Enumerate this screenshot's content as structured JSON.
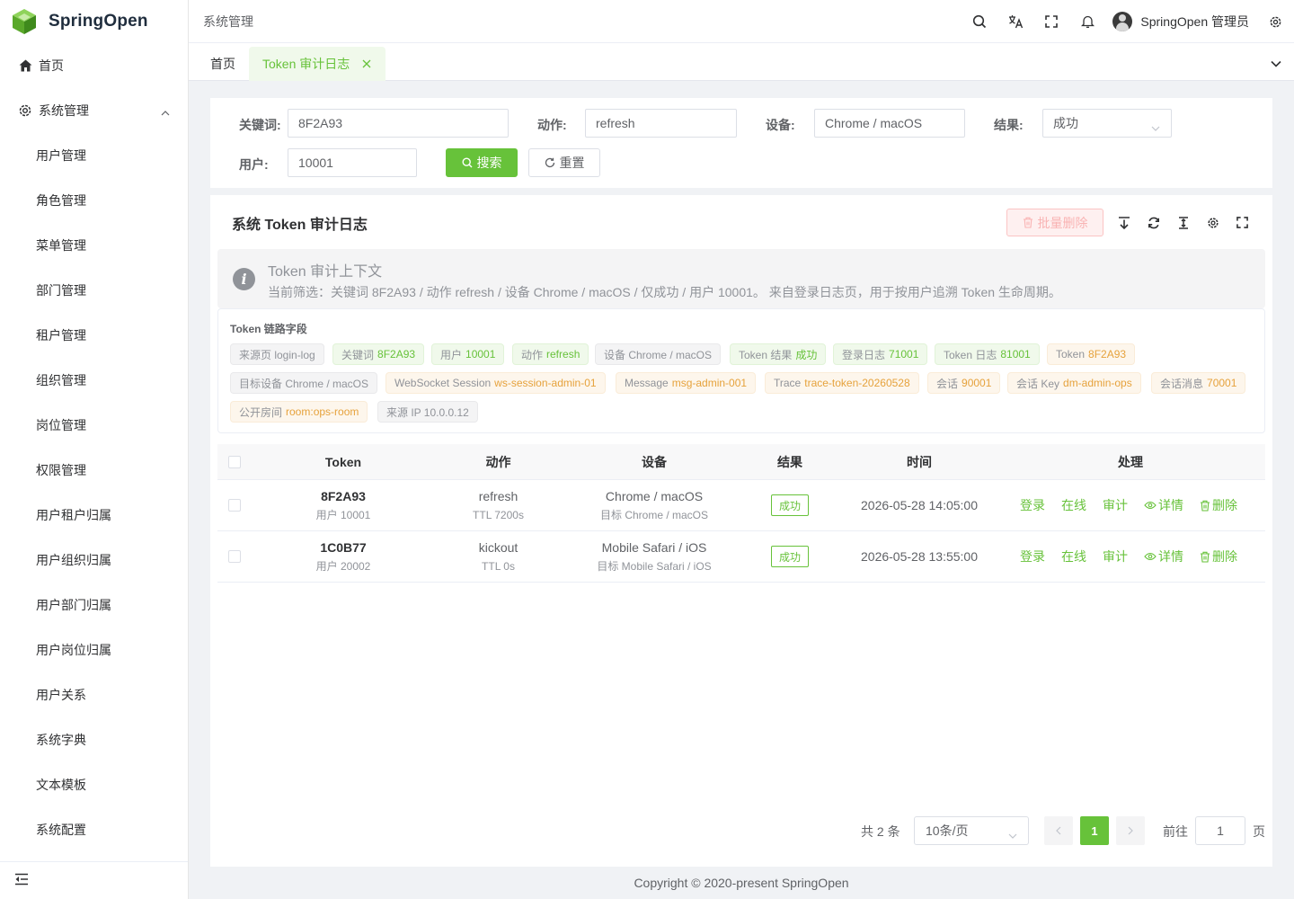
{
  "app": {
    "name": "SpringOpen"
  },
  "sidebar": {
    "home_label": "首页",
    "group_label": "系统管理",
    "items": [
      "用户管理",
      "角色管理",
      "菜单管理",
      "部门管理",
      "租户管理",
      "组织管理",
      "岗位管理",
      "权限管理",
      "用户租户归属",
      "用户组织归属",
      "用户部门归属",
      "用户岗位归属",
      "用户关系",
      "系统字典",
      "文本模板",
      "系统配置"
    ]
  },
  "header": {
    "breadcrumb": "系统管理",
    "user_name": "SpringOpen 管理员"
  },
  "tabs": {
    "home": "首页",
    "active": "Token 审计日志"
  },
  "search": {
    "keyword_label": "关键词:",
    "keyword_value": "8F2A93",
    "action_label": "动作:",
    "action_value": "refresh",
    "device_label": "设备:",
    "device_value": "Chrome / macOS",
    "result_label": "结果:",
    "result_value": "成功",
    "user_label": "用户:",
    "user_value": "10001",
    "search_button": "搜索",
    "reset_button": "重置"
  },
  "panel": {
    "title": "系统 Token 审计日志",
    "batch_delete": "批量删除",
    "alert_title": "Token 审计上下文",
    "alert_desc": "当前筛选：关键词 8F2A93 / 动作 refresh / 设备 Chrome / macOS / 仅成功 / 用户 10001。 来自登录日志页，用于按用户追溯 Token 生命周期。",
    "chain_title": "Token 链路字段",
    "tags": [
      {
        "k": "来源页 login-log",
        "v": "",
        "type": "info"
      },
      {
        "k": "关键词",
        "v": "8F2A93",
        "type": "success"
      },
      {
        "k": "用户",
        "v": "10001",
        "type": "success"
      },
      {
        "k": "动作",
        "v": "refresh",
        "type": "success"
      },
      {
        "k": "设备 Chrome / macOS",
        "v": "",
        "type": "info"
      },
      {
        "k": "Token 结果",
        "v": "成功",
        "type": "success"
      },
      {
        "k": "登录日志",
        "v": "71001",
        "type": "success"
      },
      {
        "k": "Token 日志",
        "v": "81001",
        "type": "success"
      },
      {
        "k": "Token",
        "v": "8F2A93",
        "type": "warning"
      },
      {
        "k": "目标设备 Chrome / macOS",
        "v": "",
        "type": "info"
      },
      {
        "k": "WebSocket Session",
        "v": "ws-session-admin-01",
        "type": "warning"
      },
      {
        "k": "Message",
        "v": "msg-admin-001",
        "type": "warning"
      },
      {
        "k": "Trace",
        "v": "trace-token-20260528",
        "type": "warning"
      },
      {
        "k": "会话",
        "v": "90001",
        "type": "warning"
      },
      {
        "k": "会话 Key",
        "v": "dm-admin-ops",
        "type": "warning"
      },
      {
        "k": "会话消息",
        "v": "70001",
        "type": "warning"
      },
      {
        "k": "公开房间",
        "v": "room:ops-room",
        "type": "warning"
      },
      {
        "k": "来源 IP 10.0.0.12",
        "v": "",
        "type": "info"
      }
    ]
  },
  "table": {
    "headers": [
      "Token",
      "动作",
      "设备",
      "结果",
      "时间",
      "处理"
    ],
    "rows": [
      {
        "token": "8F2A93",
        "user": "用户 10001",
        "action": "refresh",
        "ttl": "TTL 7200s",
        "device": "Chrome / macOS",
        "target": "目标 Chrome / macOS",
        "result": "成功",
        "time": "2026-05-28 14:05:00"
      },
      {
        "token": "1C0B77",
        "user": "用户 20002",
        "action": "kickout",
        "ttl": "TTL 0s",
        "device": "Mobile Safari / iOS",
        "target": "目标 Mobile Safari / iOS",
        "result": "成功",
        "time": "2026-05-28 13:55:00"
      }
    ],
    "row_actions": [
      "登录",
      "在线",
      "审计",
      "详情",
      "删除"
    ]
  },
  "pagination": {
    "total": "共 2 条",
    "page_size": "10条/页",
    "current": "1",
    "goto_label": "前往",
    "goto_value": "1",
    "suffix": "页"
  },
  "footer": {
    "copyright": "Copyright © 2020-present SpringOpen"
  },
  "colors": {
    "primary": "#67c23a",
    "danger_light": "#fef0f0",
    "info_text": "#909399"
  }
}
